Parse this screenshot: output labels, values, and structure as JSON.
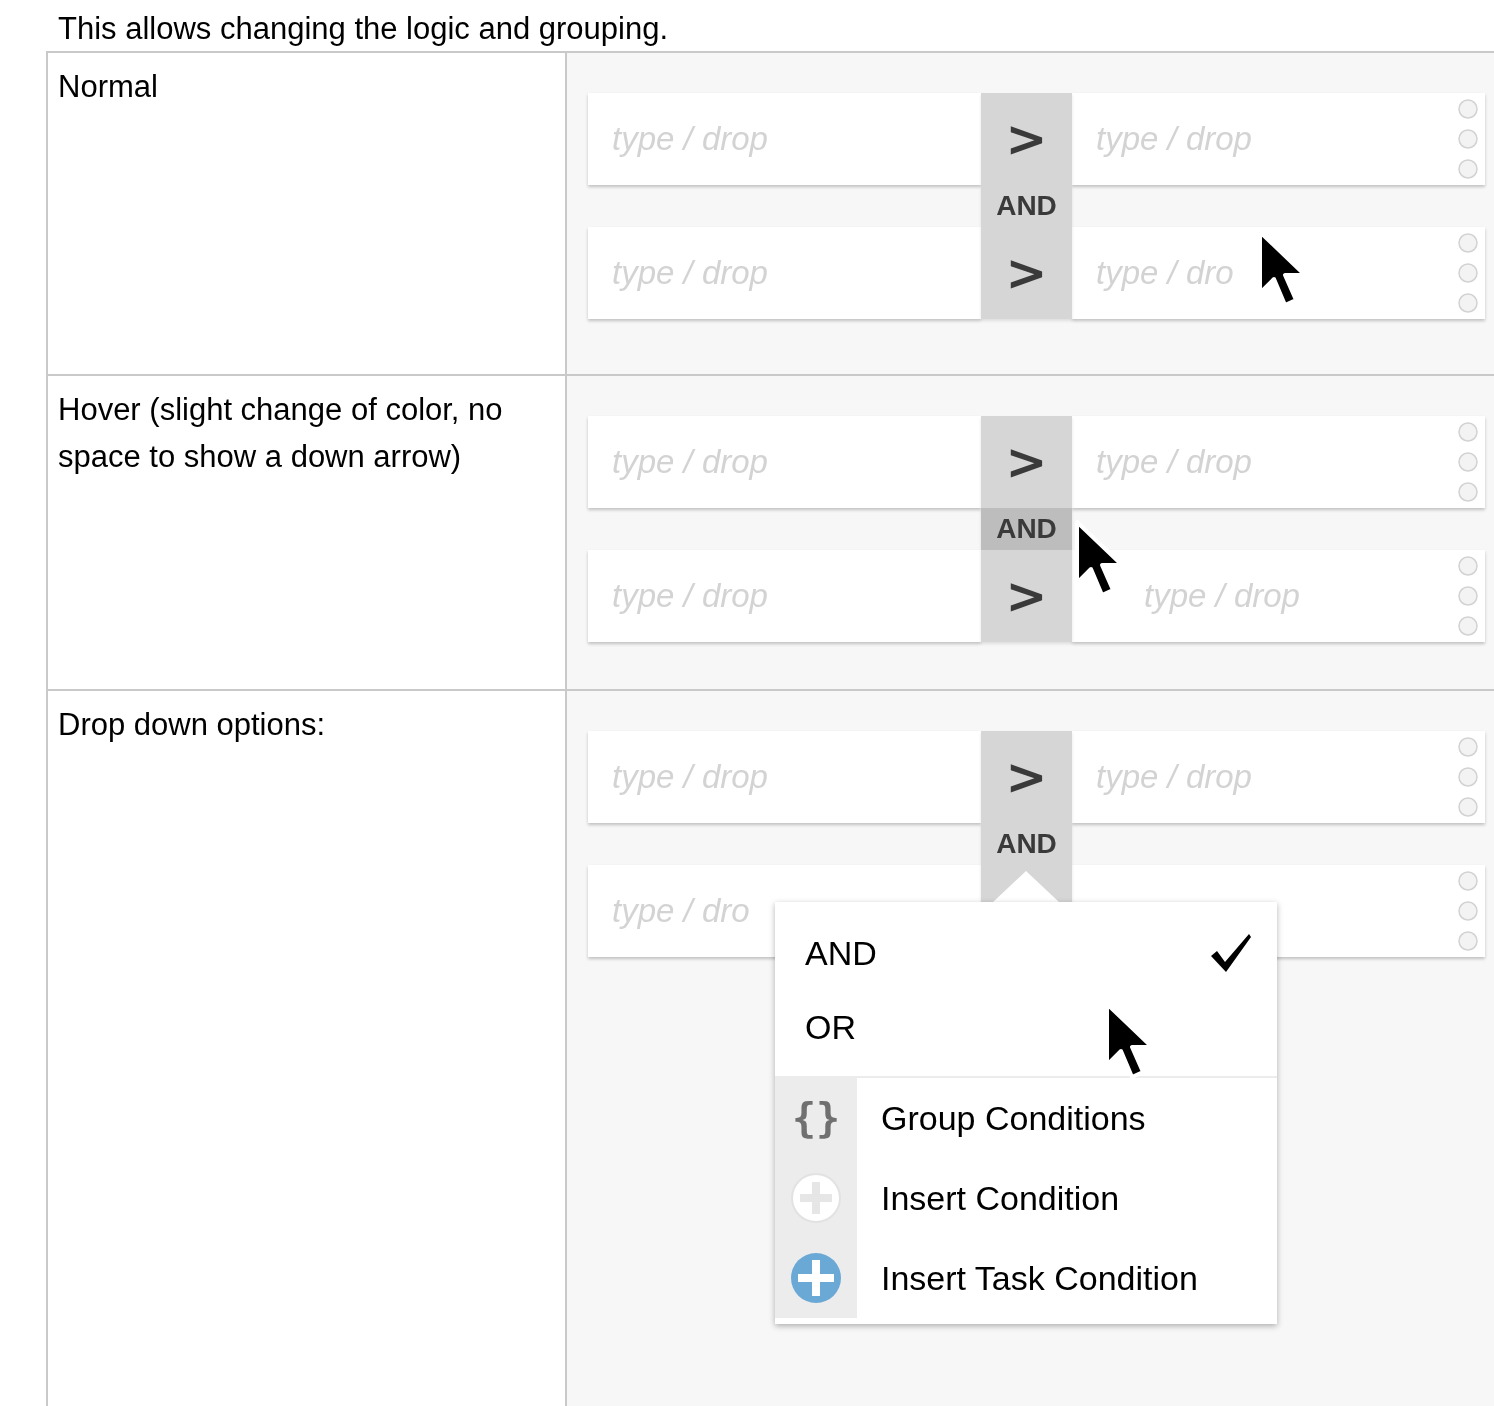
{
  "intro": "This allows changing the logic and grouping.",
  "states": [
    {
      "label": "Normal",
      "logic": "AND",
      "logic_hovered": false,
      "logic_open": false,
      "rows": [
        {
          "left": {
            "placeholder": "type / drop"
          },
          "operator": ">",
          "right": {
            "placeholder": "type / drop"
          }
        },
        {
          "left": {
            "placeholder": "type / drop"
          },
          "operator": ">",
          "right": {
            "placeholder": "type / dro"
          }
        }
      ]
    },
    {
      "label": "Hover (slight change of color, no space to show a down arrow)",
      "logic": "AND",
      "logic_hovered": true,
      "logic_open": false,
      "rows": [
        {
          "left": {
            "placeholder": "type / drop"
          },
          "operator": ">",
          "right": {
            "placeholder": "type / drop"
          }
        },
        {
          "left": {
            "placeholder": "type / drop"
          },
          "operator": ">",
          "right": {
            "placeholder": "type / drop"
          }
        }
      ]
    },
    {
      "label": "Drop down options:",
      "logic": "AND",
      "logic_hovered": false,
      "logic_open": true,
      "rows": [
        {
          "left": {
            "placeholder": "type / drop"
          },
          "operator": ">",
          "right": {
            "placeholder": "type / drop"
          }
        },
        {
          "left": {
            "placeholder": "type / dro"
          },
          "right": {}
        }
      ],
      "menu": [
        {
          "label": "AND",
          "kind": "logic",
          "checked": true
        },
        {
          "label": "OR",
          "kind": "logic",
          "checked": false
        },
        {
          "label": "Group Conditions",
          "kind": "group",
          "symbol": "{}"
        },
        {
          "label": "Insert Condition",
          "kind": "insert"
        },
        {
          "label": "Insert Task Condition",
          "kind": "task"
        }
      ]
    }
  ]
}
